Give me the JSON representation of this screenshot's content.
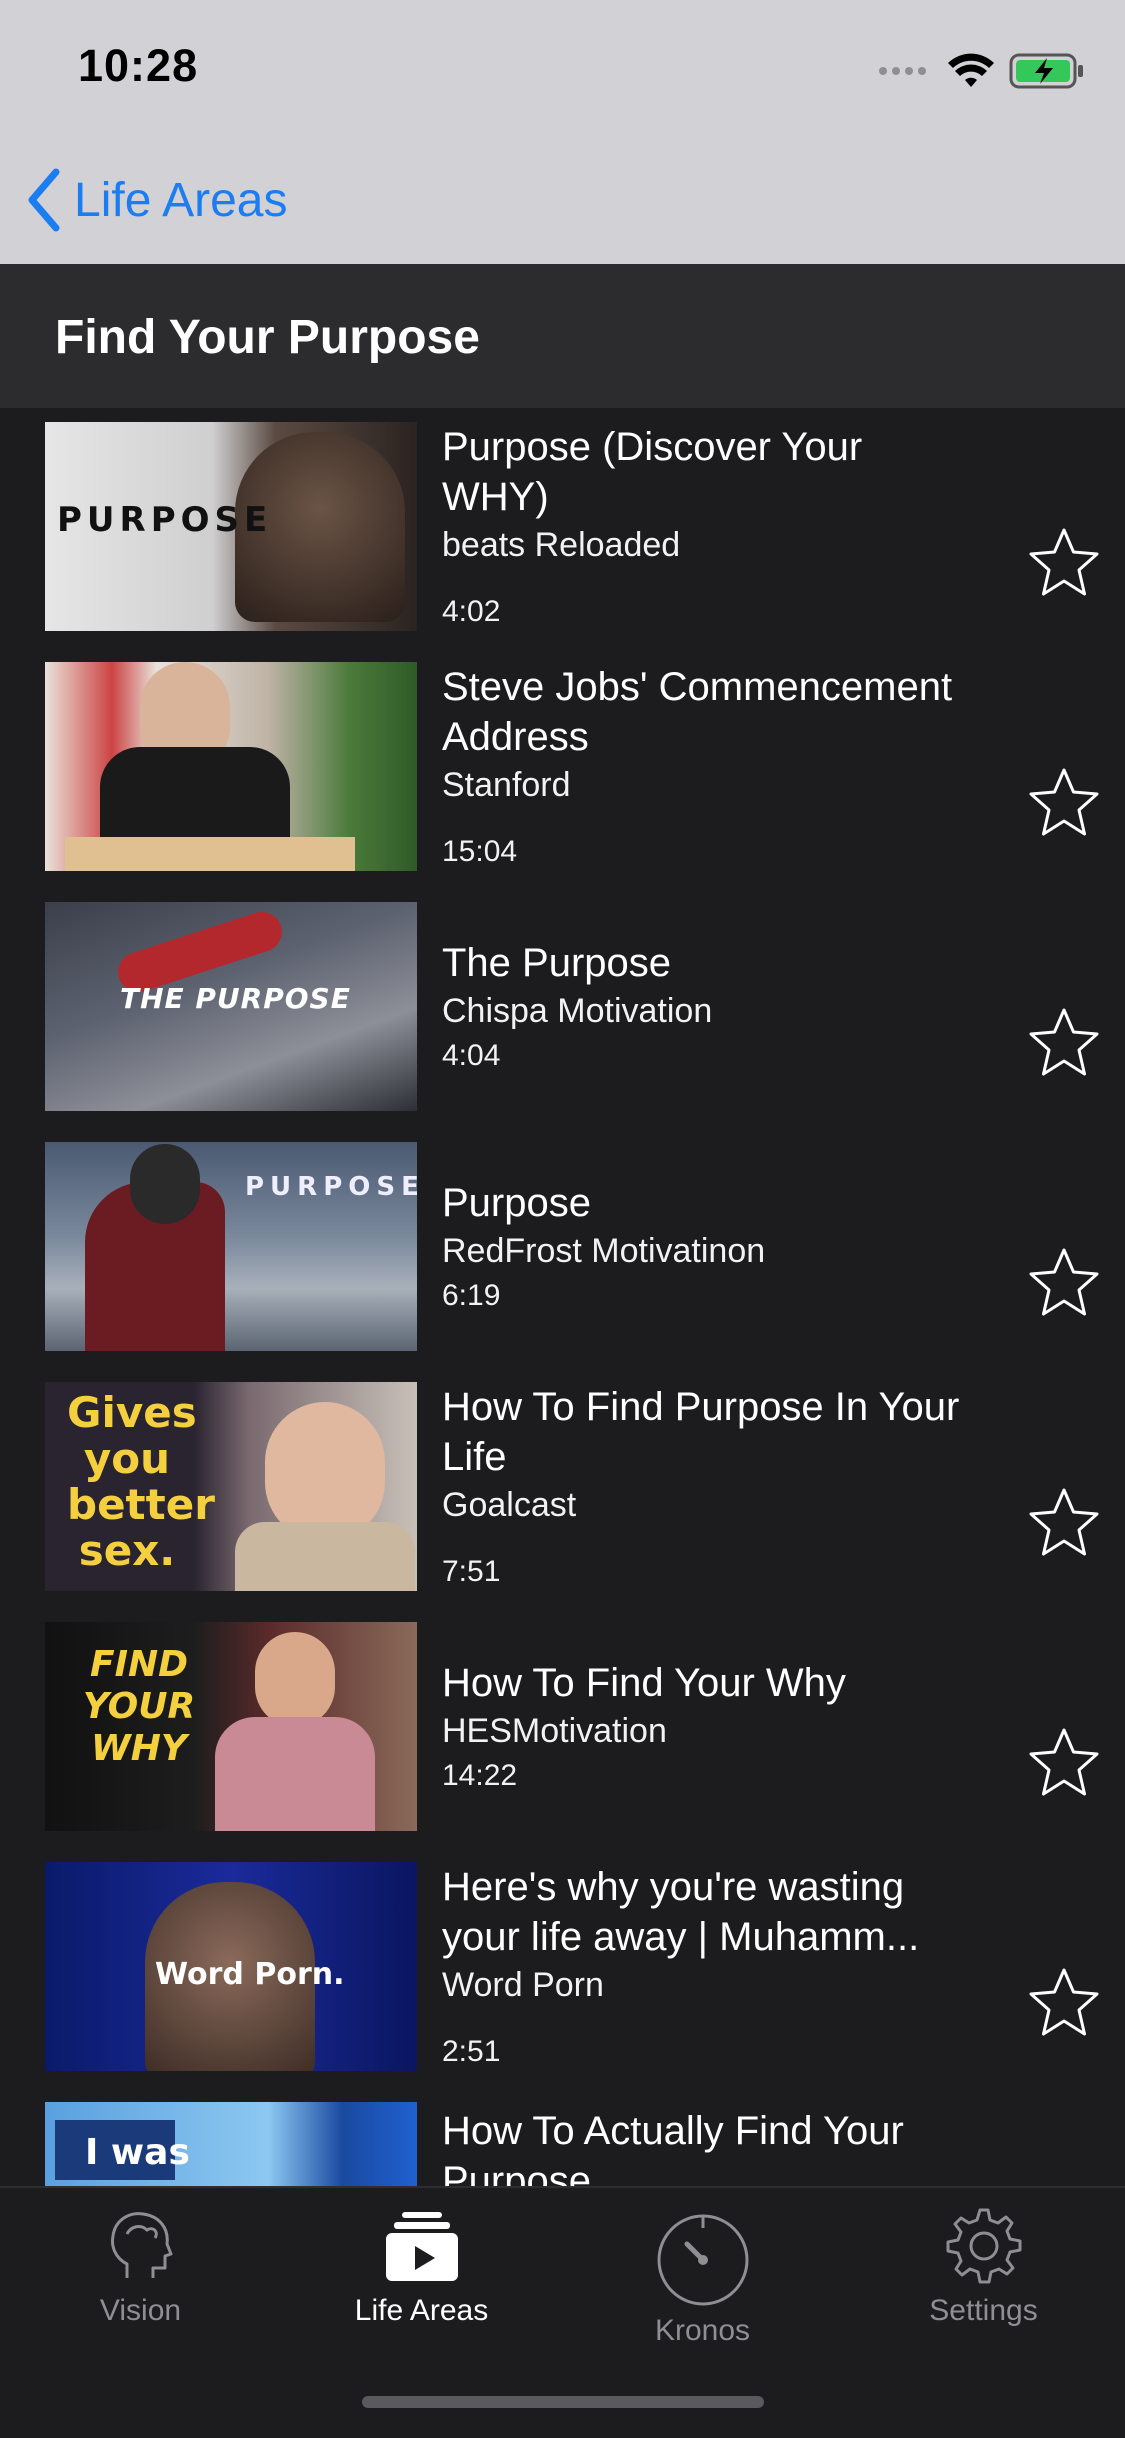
{
  "status_bar": {
    "time": "10:28"
  },
  "nav": {
    "back_label": "Life Areas"
  },
  "header": {
    "title": "Find Your Purpose"
  },
  "videos": [
    {
      "title": "Purpose (Discover Your WHY)",
      "channel": "beats Reloaded",
      "duration": "4:02",
      "thumb_text": "PURPOSE"
    },
    {
      "title": "Steve Jobs' Commencement Address",
      "channel": "Stanford",
      "duration": "15:04",
      "thumb_text": ""
    },
    {
      "title": "The Purpose",
      "channel": "Chispa Motivation",
      "duration": "4:04",
      "thumb_text": "THE PURPOSE"
    },
    {
      "title": "Purpose",
      "channel": "RedFrost Motivatinon",
      "duration": "6:19",
      "thumb_text": "PURPOSE"
    },
    {
      "title": "How To Find Purpose In Your Life",
      "channel": "Goalcast",
      "duration": "7:51",
      "thumb_text": "Gives you better sex."
    },
    {
      "title": "How To Find Your Why",
      "channel": "HESMotivation",
      "duration": "14:22",
      "thumb_text": "FIND YOUR WHY"
    },
    {
      "title": "Here's why you're wasting your life away | Muhamm...",
      "channel": "Word Porn",
      "duration": "2:51",
      "thumb_text": "Word Porn."
    },
    {
      "title": "How To Actually Find Your Purpose",
      "channel": "",
      "duration": "",
      "thumb_text": "I was"
    }
  ],
  "tabs": [
    {
      "label": "Vision",
      "icon": "head-icon",
      "active": false
    },
    {
      "label": "Life Areas",
      "icon": "video-stack-icon",
      "active": true
    },
    {
      "label": "Kronos",
      "icon": "timer-icon",
      "active": false
    },
    {
      "label": "Settings",
      "icon": "gear-icon",
      "active": false
    }
  ],
  "colors": {
    "accent": "#1a7df2",
    "background": "#1c1c1e",
    "header": "#2c2c2e",
    "bars": "#d1d1d6"
  }
}
